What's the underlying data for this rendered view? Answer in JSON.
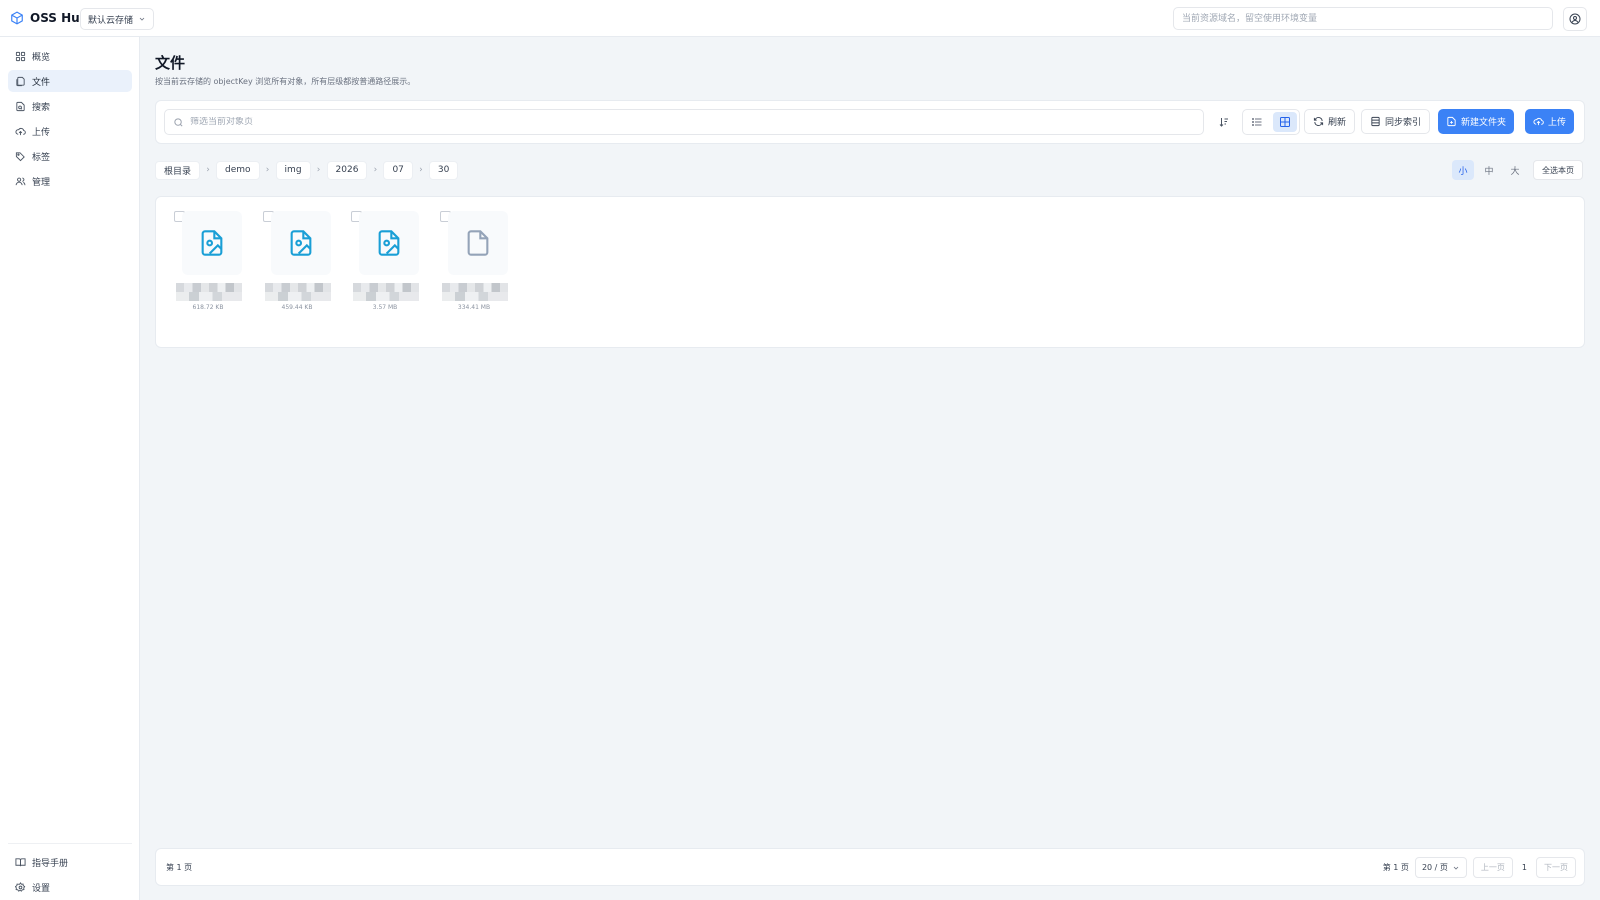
{
  "header": {
    "app_name": "OSS Hub",
    "storage_select": "默认云存储",
    "domain_placeholder": "当前资源域名，留空使用环境变量"
  },
  "sidebar": {
    "items": [
      {
        "label": "概览",
        "icon": "grid-icon"
      },
      {
        "label": "文件",
        "icon": "files-icon",
        "active": true
      },
      {
        "label": "搜索",
        "icon": "search-file-icon"
      },
      {
        "label": "上传",
        "icon": "cloud-upload-icon"
      },
      {
        "label": "标签",
        "icon": "tags-icon"
      },
      {
        "label": "管理",
        "icon": "users-icon"
      }
    ],
    "bottom_items": [
      {
        "label": "指导手册",
        "icon": "book-icon"
      },
      {
        "label": "设置",
        "icon": "gear-icon"
      }
    ]
  },
  "page": {
    "title": "文件",
    "description": "按当前云存储的 objectKey 浏览所有对象，所有层级都按普通路径展示。"
  },
  "toolbar": {
    "filter_placeholder": "筛选当前对象页",
    "refresh_label": "刷新",
    "sync_label": "同步索引",
    "new_folder_label": "新建文件夹",
    "upload_label": "上传",
    "active_view": "grid"
  },
  "breadcrumb": [
    "根目录",
    "demo",
    "img",
    "2026",
    "07",
    "30"
  ],
  "size_options": [
    "小",
    "中",
    "大"
  ],
  "active_size": "小",
  "select_all_label": "全选本页",
  "files": [
    {
      "type": "image",
      "size": "618.72 KB"
    },
    {
      "type": "image",
      "size": "459.44 KB"
    },
    {
      "type": "image",
      "size": "3.57 MB"
    },
    {
      "type": "file",
      "size": "334.41 MB"
    }
  ],
  "pagination": {
    "left_label": "第 1 页",
    "page_label": "第 1 页",
    "per_page": "20 / 页",
    "prev_label": "上一页",
    "current": "1",
    "next_label": "下一页"
  },
  "colors": {
    "primary": "#3b82f6",
    "file_icon": "#1a9fd6",
    "generic_icon": "#94a3b8"
  }
}
